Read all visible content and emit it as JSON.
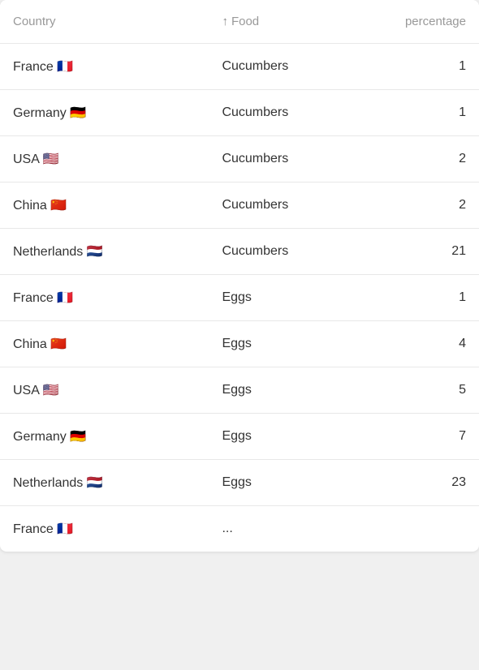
{
  "table": {
    "headers": {
      "country": "Country",
      "food": "Food",
      "food_sort_arrow": "↑",
      "percentage": "percentage"
    },
    "rows": [
      {
        "country": "France 🇫🇷",
        "food": "Cucumbers",
        "percentage": "1"
      },
      {
        "country": "Germany 🇩🇪",
        "food": "Cucumbers",
        "percentage": "1"
      },
      {
        "country": "USA 🇺🇸",
        "food": "Cucumbers",
        "percentage": "2"
      },
      {
        "country": "China 🇨🇳",
        "food": "Cucumbers",
        "percentage": "2"
      },
      {
        "country": "Netherlands 🇳🇱",
        "food": "Cucumbers",
        "percentage": "21"
      },
      {
        "country": "France 🇫🇷",
        "food": "Eggs",
        "percentage": "1"
      },
      {
        "country": "China 🇨🇳",
        "food": "Eggs",
        "percentage": "4"
      },
      {
        "country": "USA 🇺🇸",
        "food": "Eggs",
        "percentage": "5"
      },
      {
        "country": "Germany 🇩🇪",
        "food": "Eggs",
        "percentage": "7"
      },
      {
        "country": "Netherlands 🇳🇱",
        "food": "Eggs",
        "percentage": "23"
      },
      {
        "country": "France 🇫🇷",
        "food": "...",
        "percentage": ""
      }
    ]
  }
}
